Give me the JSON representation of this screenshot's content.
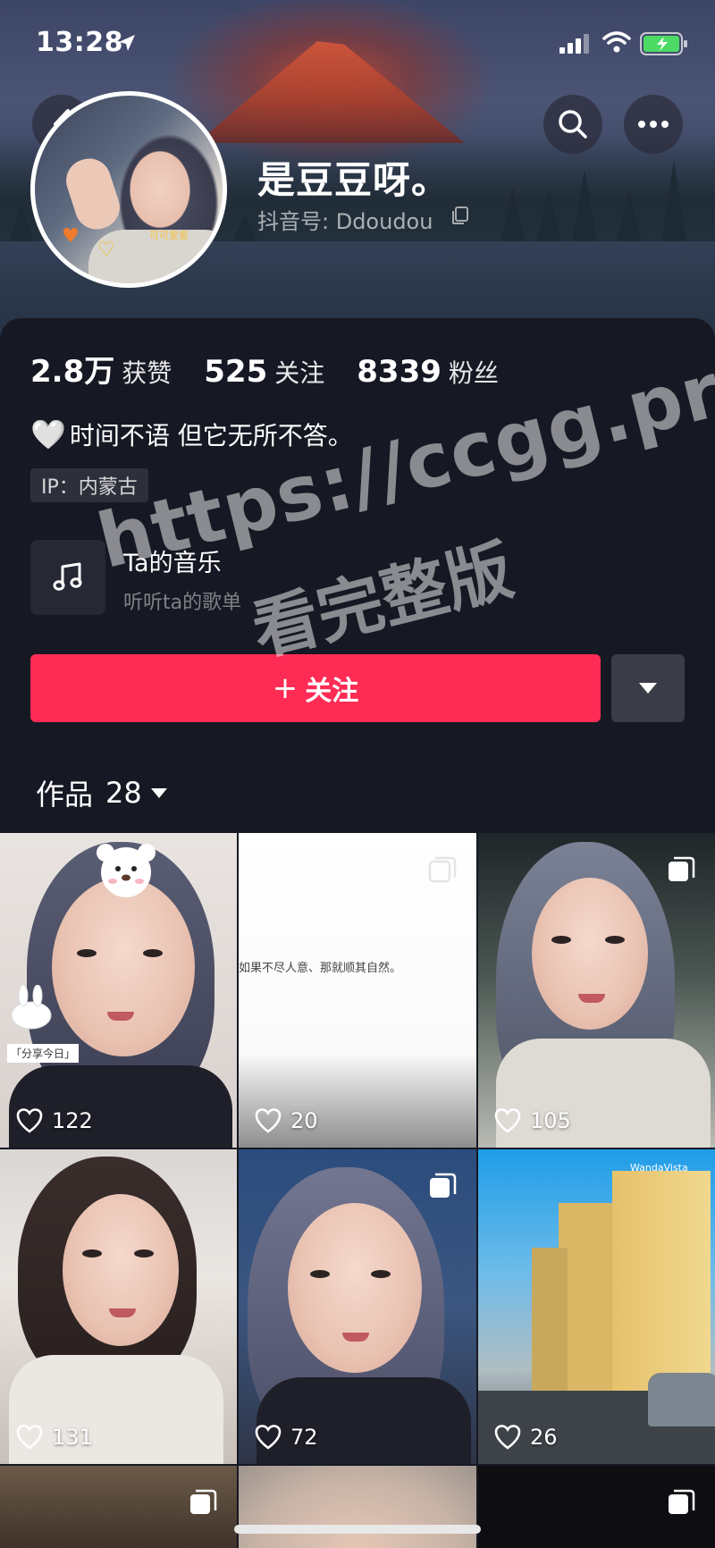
{
  "status": {
    "time": "13:28"
  },
  "profile": {
    "name": "是豆豆呀。",
    "douyin_id": "抖音号: Ddoudou",
    "avatar_sticker": "可可爱爱",
    "stats": [
      {
        "value": "2.8万",
        "label": "获赞"
      },
      {
        "value": "525",
        "label": "关注"
      },
      {
        "value": "8339",
        "label": "粉丝"
      }
    ],
    "bio": "时间不语 但它无所不答。",
    "bio_emoji": "🤍",
    "ip": "IP：内蒙古",
    "music_title": "Ta的音乐",
    "music_subtitle": "听听ta的歌单",
    "follow_label": "关注",
    "follow_plus": "+"
  },
  "works": {
    "label": "作品",
    "count": "28"
  },
  "videos": [
    {
      "likes": "122",
      "sticker_text": "「分享今日」"
    },
    {
      "likes": "20",
      "caption": "如果不尽人意、那就顺其自然。"
    },
    {
      "likes": "105"
    },
    {
      "likes": "131"
    },
    {
      "likes": "72"
    },
    {
      "likes": "26",
      "sign_text": "WandaVista"
    },
    {},
    {},
    {}
  ],
  "watermark": {
    "line1": "https://ccgg.pro",
    "line2": "看完整版"
  },
  "colors": {
    "accent": "#fe2c55",
    "background": "#161823"
  }
}
